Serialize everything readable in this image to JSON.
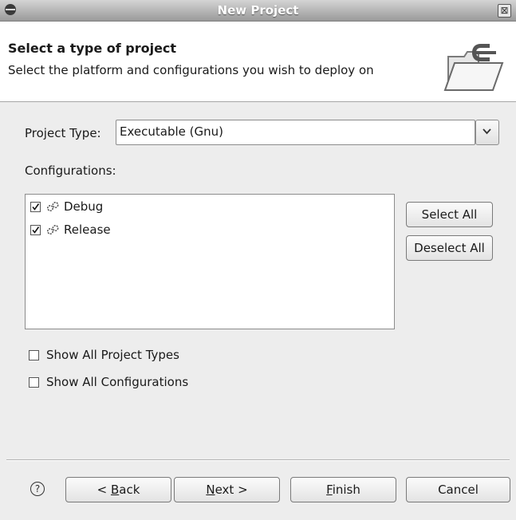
{
  "window": {
    "title": "New Project",
    "close_glyph": "⊠"
  },
  "header": {
    "title": "Select a type of project",
    "description": "Select the platform and configurations you wish to deploy on",
    "icon": "folder-c-wizard-icon"
  },
  "form": {
    "project_type_label": "Project Type:",
    "project_type_value": "Executable (Gnu)",
    "configurations_label": "Configurations:",
    "configurations": [
      {
        "label": "Debug",
        "checked": true,
        "icon": "gear-icon"
      },
      {
        "label": "Release",
        "checked": true,
        "icon": "gear-icon"
      }
    ],
    "select_all_label": "Select All",
    "deselect_all_label": "Deselect All",
    "show_all_project_types_label": "Show All Project Types",
    "show_all_project_types_checked": false,
    "show_all_configurations_label": "Show All Configurations",
    "show_all_configurations_checked": false
  },
  "footer": {
    "help_glyph": "?",
    "back": {
      "pre": "< ",
      "mnemonic": "B",
      "rest": "ack"
    },
    "next": {
      "mnemonic": "N",
      "rest": "ext >"
    },
    "finish": {
      "mnemonic": "F",
      "rest": "inish"
    },
    "cancel_label": "Cancel"
  },
  "colors": {
    "titlebar_top": "#d4d4d4",
    "titlebar_bottom": "#9a9a9a",
    "background": "#ededed",
    "panel": "#ffffff"
  }
}
